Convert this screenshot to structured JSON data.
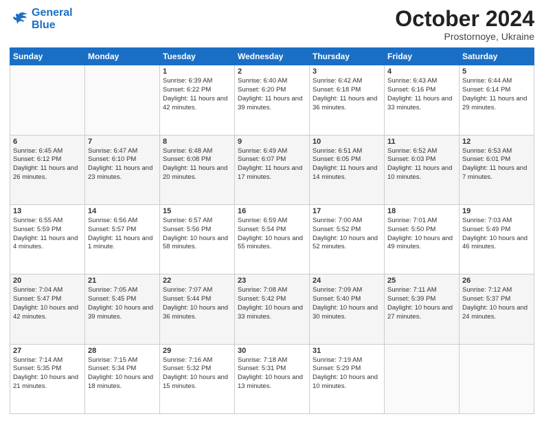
{
  "header": {
    "logo_line1": "General",
    "logo_line2": "Blue",
    "month": "October 2024",
    "location": "Prostornoye, Ukraine"
  },
  "weekdays": [
    "Sunday",
    "Monday",
    "Tuesday",
    "Wednesday",
    "Thursday",
    "Friday",
    "Saturday"
  ],
  "weeks": [
    [
      {
        "day": "",
        "info": ""
      },
      {
        "day": "",
        "info": ""
      },
      {
        "day": "1",
        "info": "Sunrise: 6:39 AM\nSunset: 6:22 PM\nDaylight: 11 hours and 42 minutes."
      },
      {
        "day": "2",
        "info": "Sunrise: 6:40 AM\nSunset: 6:20 PM\nDaylight: 11 hours and 39 minutes."
      },
      {
        "day": "3",
        "info": "Sunrise: 6:42 AM\nSunset: 6:18 PM\nDaylight: 11 hours and 36 minutes."
      },
      {
        "day": "4",
        "info": "Sunrise: 6:43 AM\nSunset: 6:16 PM\nDaylight: 11 hours and 33 minutes."
      },
      {
        "day": "5",
        "info": "Sunrise: 6:44 AM\nSunset: 6:14 PM\nDaylight: 11 hours and 29 minutes."
      }
    ],
    [
      {
        "day": "6",
        "info": "Sunrise: 6:45 AM\nSunset: 6:12 PM\nDaylight: 11 hours and 26 minutes."
      },
      {
        "day": "7",
        "info": "Sunrise: 6:47 AM\nSunset: 6:10 PM\nDaylight: 11 hours and 23 minutes."
      },
      {
        "day": "8",
        "info": "Sunrise: 6:48 AM\nSunset: 6:08 PM\nDaylight: 11 hours and 20 minutes."
      },
      {
        "day": "9",
        "info": "Sunrise: 6:49 AM\nSunset: 6:07 PM\nDaylight: 11 hours and 17 minutes."
      },
      {
        "day": "10",
        "info": "Sunrise: 6:51 AM\nSunset: 6:05 PM\nDaylight: 11 hours and 14 minutes."
      },
      {
        "day": "11",
        "info": "Sunrise: 6:52 AM\nSunset: 6:03 PM\nDaylight: 11 hours and 10 minutes."
      },
      {
        "day": "12",
        "info": "Sunrise: 6:53 AM\nSunset: 6:01 PM\nDaylight: 11 hours and 7 minutes."
      }
    ],
    [
      {
        "day": "13",
        "info": "Sunrise: 6:55 AM\nSunset: 5:59 PM\nDaylight: 11 hours and 4 minutes."
      },
      {
        "day": "14",
        "info": "Sunrise: 6:56 AM\nSunset: 5:57 PM\nDaylight: 11 hours and 1 minute."
      },
      {
        "day": "15",
        "info": "Sunrise: 6:57 AM\nSunset: 5:56 PM\nDaylight: 10 hours and 58 minutes."
      },
      {
        "day": "16",
        "info": "Sunrise: 6:59 AM\nSunset: 5:54 PM\nDaylight: 10 hours and 55 minutes."
      },
      {
        "day": "17",
        "info": "Sunrise: 7:00 AM\nSunset: 5:52 PM\nDaylight: 10 hours and 52 minutes."
      },
      {
        "day": "18",
        "info": "Sunrise: 7:01 AM\nSunset: 5:50 PM\nDaylight: 10 hours and 49 minutes."
      },
      {
        "day": "19",
        "info": "Sunrise: 7:03 AM\nSunset: 5:49 PM\nDaylight: 10 hours and 46 minutes."
      }
    ],
    [
      {
        "day": "20",
        "info": "Sunrise: 7:04 AM\nSunset: 5:47 PM\nDaylight: 10 hours and 42 minutes."
      },
      {
        "day": "21",
        "info": "Sunrise: 7:05 AM\nSunset: 5:45 PM\nDaylight: 10 hours and 39 minutes."
      },
      {
        "day": "22",
        "info": "Sunrise: 7:07 AM\nSunset: 5:44 PM\nDaylight: 10 hours and 36 minutes."
      },
      {
        "day": "23",
        "info": "Sunrise: 7:08 AM\nSunset: 5:42 PM\nDaylight: 10 hours and 33 minutes."
      },
      {
        "day": "24",
        "info": "Sunrise: 7:09 AM\nSunset: 5:40 PM\nDaylight: 10 hours and 30 minutes."
      },
      {
        "day": "25",
        "info": "Sunrise: 7:11 AM\nSunset: 5:39 PM\nDaylight: 10 hours and 27 minutes."
      },
      {
        "day": "26",
        "info": "Sunrise: 7:12 AM\nSunset: 5:37 PM\nDaylight: 10 hours and 24 minutes."
      }
    ],
    [
      {
        "day": "27",
        "info": "Sunrise: 7:14 AM\nSunset: 5:35 PM\nDaylight: 10 hours and 21 minutes."
      },
      {
        "day": "28",
        "info": "Sunrise: 7:15 AM\nSunset: 5:34 PM\nDaylight: 10 hours and 18 minutes."
      },
      {
        "day": "29",
        "info": "Sunrise: 7:16 AM\nSunset: 5:32 PM\nDaylight: 10 hours and 15 minutes."
      },
      {
        "day": "30",
        "info": "Sunrise: 7:18 AM\nSunset: 5:31 PM\nDaylight: 10 hours and 13 minutes."
      },
      {
        "day": "31",
        "info": "Sunrise: 7:19 AM\nSunset: 5:29 PM\nDaylight: 10 hours and 10 minutes."
      },
      {
        "day": "",
        "info": ""
      },
      {
        "day": "",
        "info": ""
      }
    ]
  ]
}
